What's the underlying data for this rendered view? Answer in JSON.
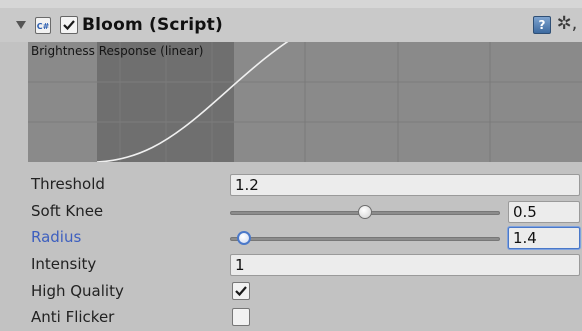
{
  "header": {
    "title": "Bloom (Script)",
    "script_icon": "script-icon",
    "enabled": true,
    "help_icon": "help-icon",
    "settings_icon": "gear-icon",
    "help_glyph": "?",
    "gear_glyph": "✲,",
    "script_glyph": "C#"
  },
  "graph": {
    "label": "Brightness Response (linear)"
  },
  "properties": {
    "threshold": {
      "label": "Threshold",
      "value": "1.2"
    },
    "soft_knee": {
      "label": "Soft Knee",
      "value": "0.5",
      "slider_fraction": 0.5
    },
    "radius": {
      "label": "Radius",
      "value": "1.4",
      "slider_fraction": 0.05
    },
    "intensity": {
      "label": "Intensity",
      "value": "1"
    },
    "high_quality": {
      "label": "High Quality",
      "checked": true
    },
    "anti_flicker": {
      "label": "Anti Flicker",
      "checked": false
    }
  },
  "colors": {
    "accent": "#3d5fbf",
    "panel_bg": "#c2c2c2",
    "graph_bg": "#8a8a8a",
    "graph_knee_bg": "#6f6f6f",
    "curve": "#f0f0f0"
  }
}
